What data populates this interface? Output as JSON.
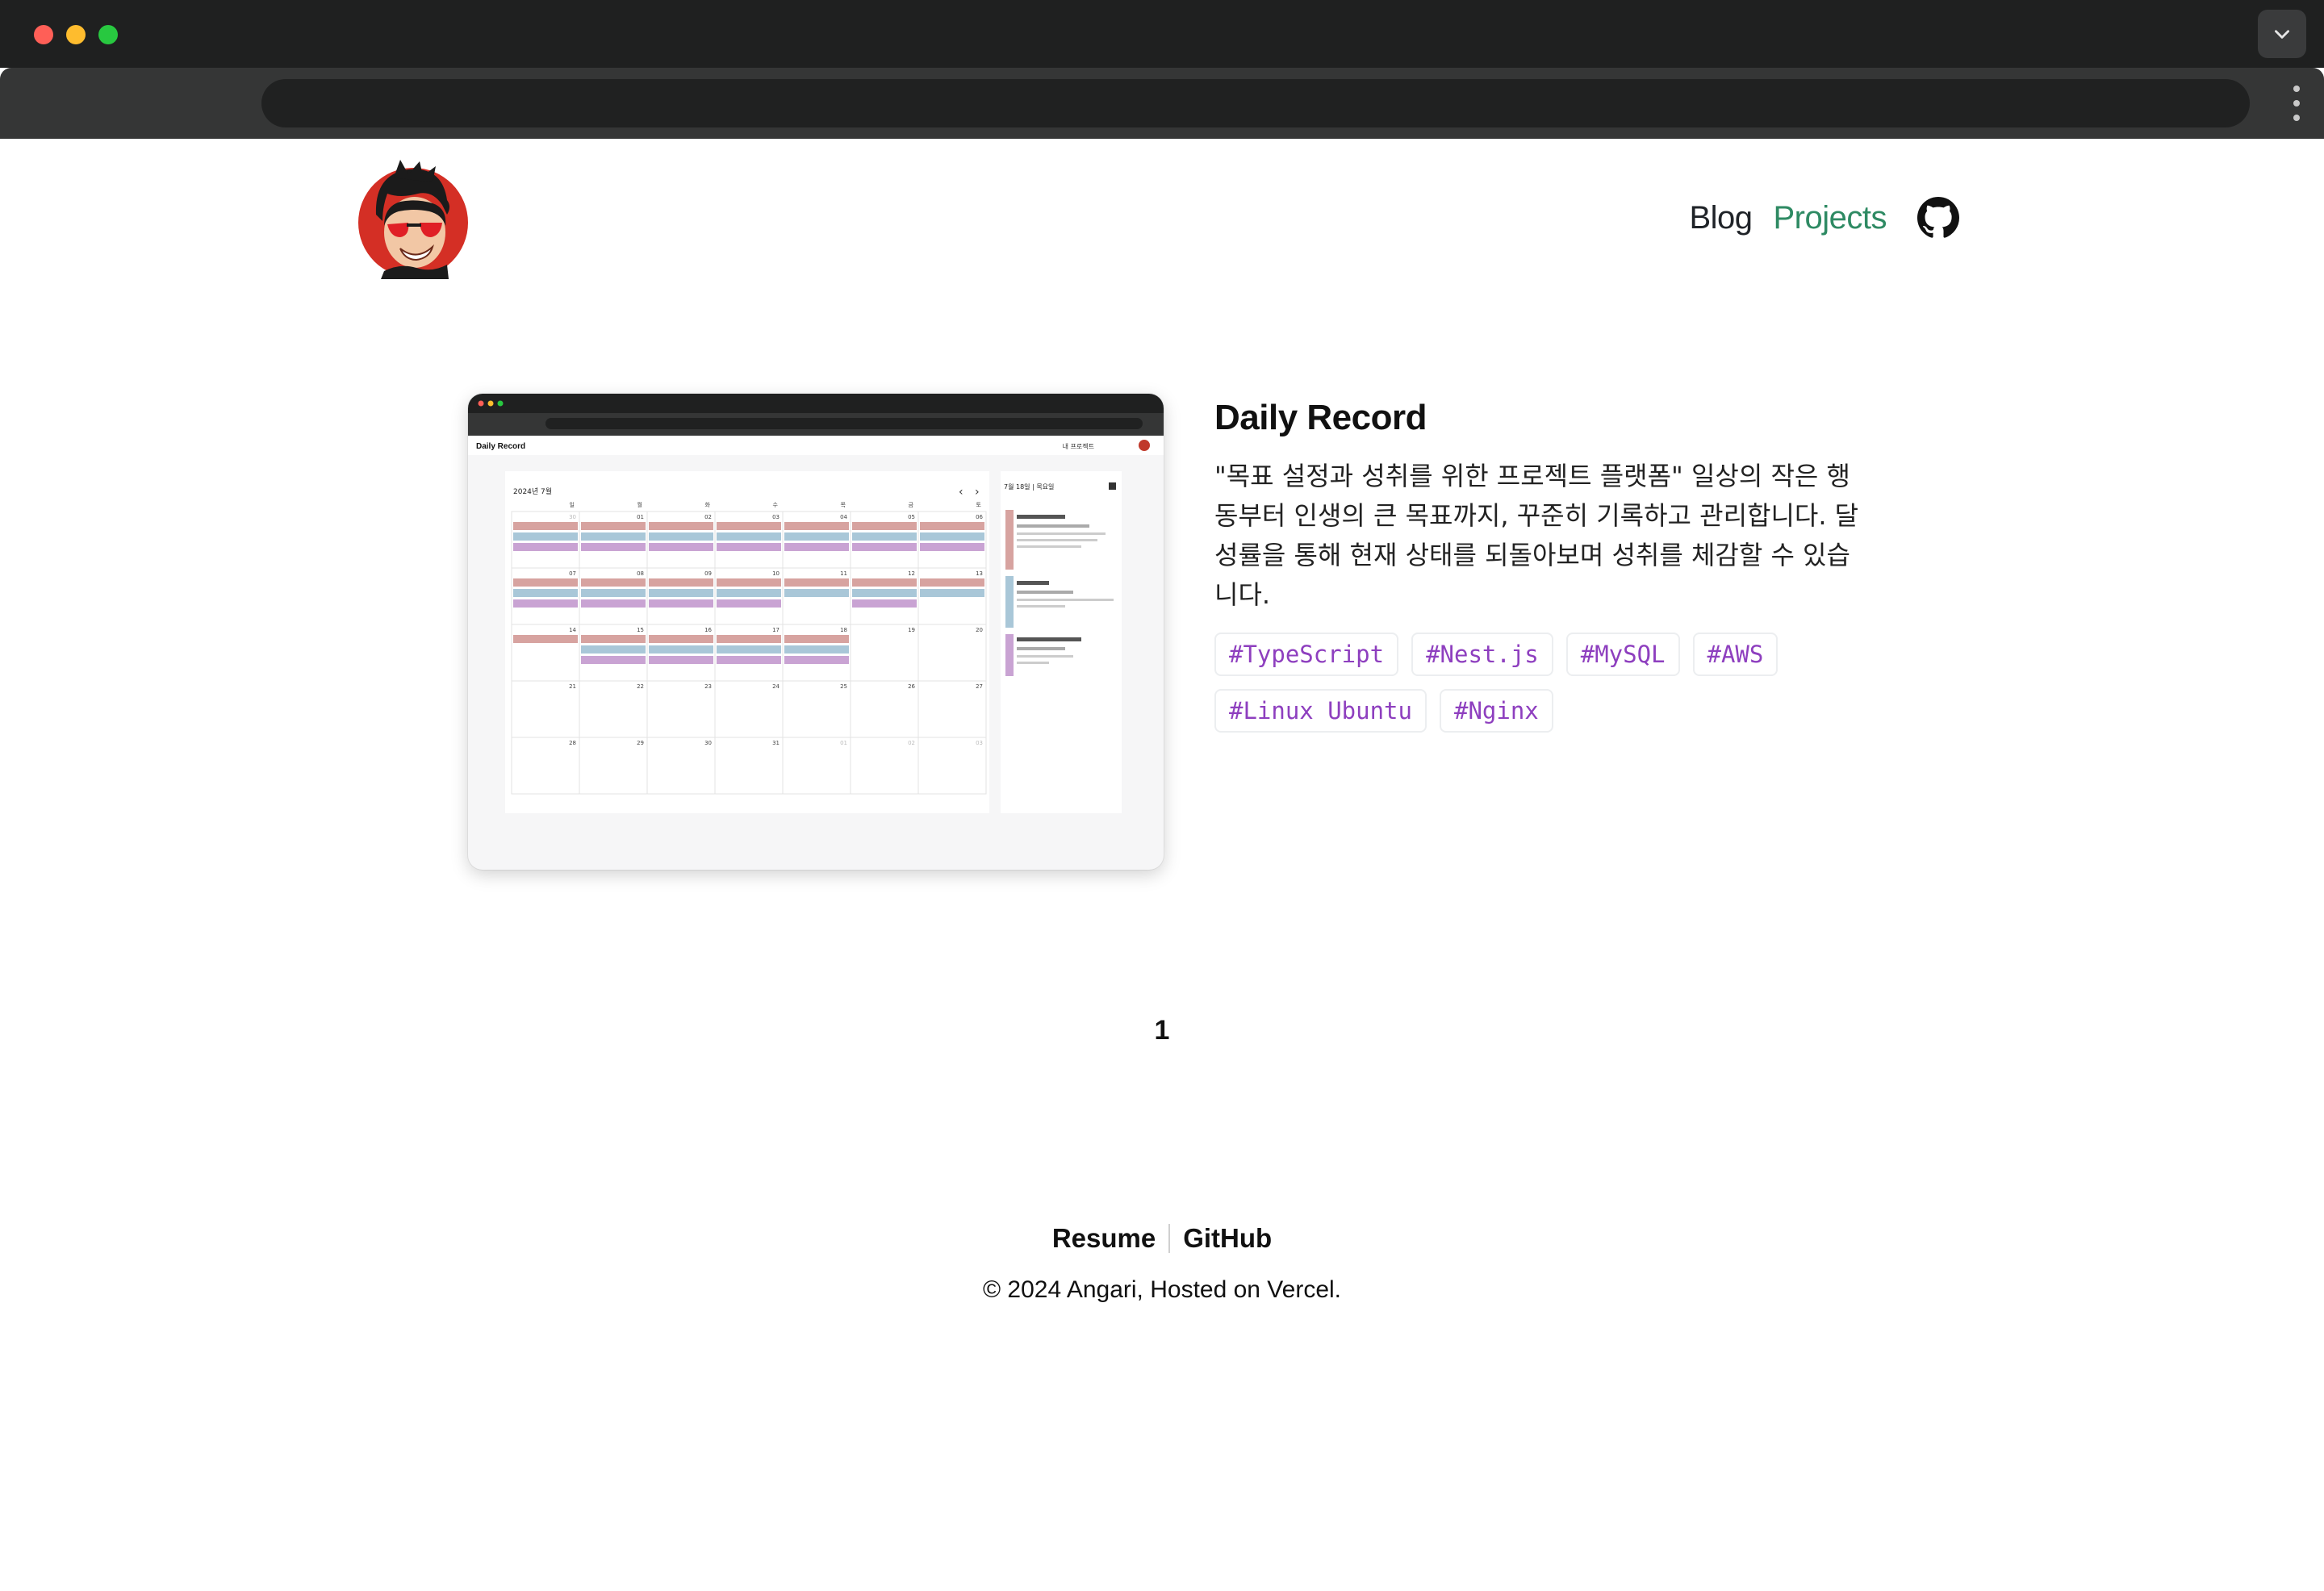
{
  "browser": {
    "url": "",
    "window_controls": [
      "close",
      "minimize",
      "maximize"
    ]
  },
  "header": {
    "avatar_icon": "cartoon-avatar-with-red-sunglasses",
    "nav": [
      {
        "label": "Blog",
        "active": false
      },
      {
        "label": "Projects",
        "active": true
      }
    ],
    "github_icon": "github-icon",
    "accent_color": "#2e8a63"
  },
  "project": {
    "title": "Daily Record",
    "description": "\"목표 설정과 성취를 위한 프로젝트 플랫폼\" 일상의 작은 행동부터 인생의 큰 목표까지, 꾸준히 기록하고 관리합니다. 달성률을 통해 현재 상태를 되돌아보며 성취를 체감할 수 있습니다.",
    "tags": [
      "#TypeScript",
      "#Nest.js",
      "#MySQL",
      "#AWS",
      "#Linux Ubuntu",
      "#Nginx"
    ],
    "tag_color": "#8e3fbf",
    "thumbnail": {
      "app_name": "Daily Record",
      "nav_label": "내 프로젝트",
      "month_label": "2024년 7월",
      "weekdays": [
        "일",
        "월",
        "화",
        "수",
        "목",
        "금",
        "토"
      ],
      "dates": [
        "30",
        "01",
        "02",
        "03",
        "04",
        "05",
        "06",
        "07",
        "08",
        "09",
        "10",
        "11",
        "12",
        "13",
        "14",
        "15",
        "16",
        "17",
        "18",
        "19",
        "20",
        "21",
        "22",
        "23",
        "24",
        "25",
        "26",
        "27",
        "28",
        "29",
        "30",
        "31",
        "01",
        "02",
        "03"
      ],
      "side_date": "7월 18일 | 목요일"
    }
  },
  "pagination": {
    "current": "1"
  },
  "footer": {
    "links": [
      "Resume",
      "GitHub"
    ],
    "copyright": "© 2024 Angari, Hosted on Vercel."
  }
}
